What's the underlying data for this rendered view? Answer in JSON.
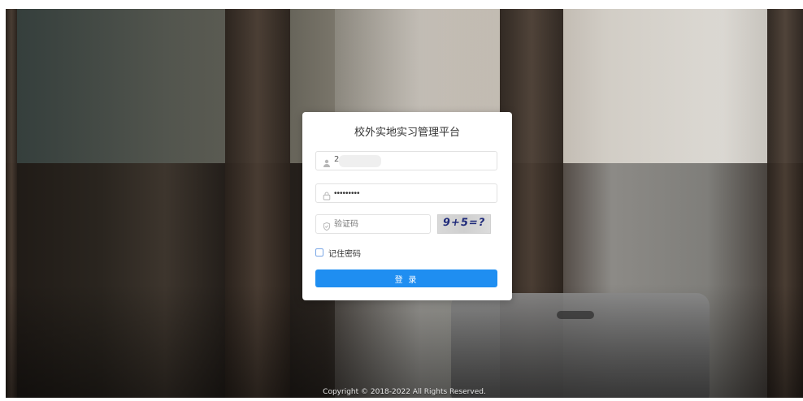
{
  "login": {
    "title": "校外实地实习管理平台",
    "username_value_prefix": "2",
    "password_value": "•••••••••",
    "captcha_placeholder": "验证码",
    "captcha_text": "9+5=?",
    "remember_label": "记住密码",
    "login_button_label": "登 录"
  },
  "footer": {
    "copyright": "Copyright © 2018-2022 All Rights Reserved."
  },
  "icons": {
    "user": "user-icon",
    "lock": "lock-icon",
    "shield": "shield-icon"
  },
  "colors": {
    "primary": "#1f8ef1"
  }
}
